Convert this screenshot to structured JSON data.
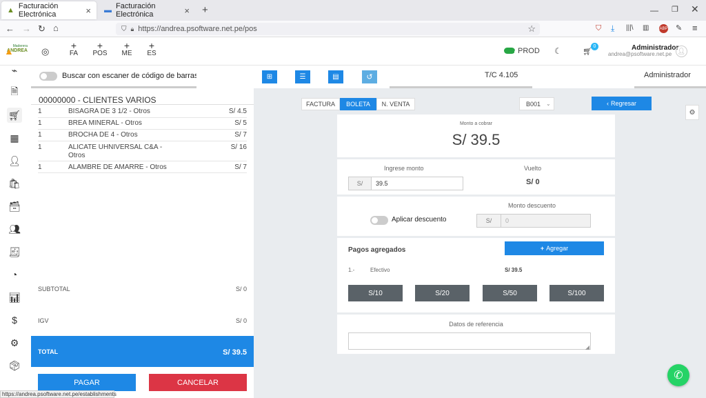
{
  "browser": {
    "tabs": [
      {
        "label": "Facturación Electrónica",
        "active": true
      },
      {
        "label": "Facturación Electrónica",
        "active": false
      }
    ],
    "new_tab": "+",
    "url": "https://andrea.psoftware.net.pe/pos",
    "status_url": "https://andrea.psoftware.net.pe/establishments"
  },
  "header": {
    "logo_top": "Maderera",
    "logo_bottom": "ANDREA",
    "quick_actions": [
      {
        "plus": "+",
        "label": "FA"
      },
      {
        "plus": "+",
        "label": "POS"
      },
      {
        "plus": "+",
        "label": "ME"
      },
      {
        "plus": "+",
        "label": "ES"
      }
    ],
    "env_label": "PROD",
    "cart_count": "0",
    "user_name": "Administrador",
    "user_email": "andrea@psoftware.net.pe"
  },
  "left": {
    "scanner_label": "Buscar con escaner de código de barras",
    "client": "00000000 - CLIENTES VARIOS",
    "items": [
      {
        "qty": "1",
        "name": "BISAGRA DE 3 1/2 - Otros",
        "price": "S/ 4.5"
      },
      {
        "qty": "1",
        "name": "BREA MINERAL - Otros",
        "price": "S/ 5"
      },
      {
        "qty": "1",
        "name": "BROCHA DE 4 - Otros",
        "price": "S/ 7"
      },
      {
        "qty": "1",
        "name": "ALICATE UHNIVERSAL C&A -",
        "name2": "Otros",
        "price": "S/ 16"
      },
      {
        "qty": "1",
        "name": "ALAMBRE DE AMARRE - Otros",
        "price": "S/ 7"
      }
    ],
    "subtotal_label": "SUBTOTAL",
    "subtotal_value": "S/ 0",
    "igv_label": "IGV",
    "igv_value": "S/ 0",
    "total_label": "TOTAL",
    "total_value": "S/ 39.5",
    "pay_button": "PAGAR",
    "cancel_button": "CANCELAR"
  },
  "top_bar": {
    "tc_label": "T/C 4.105",
    "user_label": "Administrador"
  },
  "doc_types": [
    "FACTURA",
    "BOLETA",
    "N. VENTA"
  ],
  "doc_type_selected": "BOLETA",
  "series": "B001",
  "back_button": "Regresar",
  "payment": {
    "amount_label": "Monto a cobrar",
    "amount_value": "S/ 39.5",
    "input_label": "Ingrese monto",
    "currency": "S/",
    "input_value": "39.5",
    "change_label": "Vuelto",
    "change_value": "S/ 0",
    "discount_toggle_label": "Aplicar descuento",
    "discount_label": "Monto descuento",
    "discount_placeholder": "0",
    "payments_title": "Pagos agregados",
    "add_button": "Agregar",
    "payments": [
      {
        "index": "1.-",
        "method": "Efectivo",
        "amount": "S/ 39.5"
      }
    ],
    "quick_amounts": [
      "S/10",
      "S/20",
      "S/50",
      "S/100"
    ],
    "reference_label": "Datos de referencia"
  },
  "colors": {
    "primary": "#1e88e5",
    "danger": "#dc3545",
    "grey_button": "#5a6268",
    "whatsapp": "#25d366"
  }
}
